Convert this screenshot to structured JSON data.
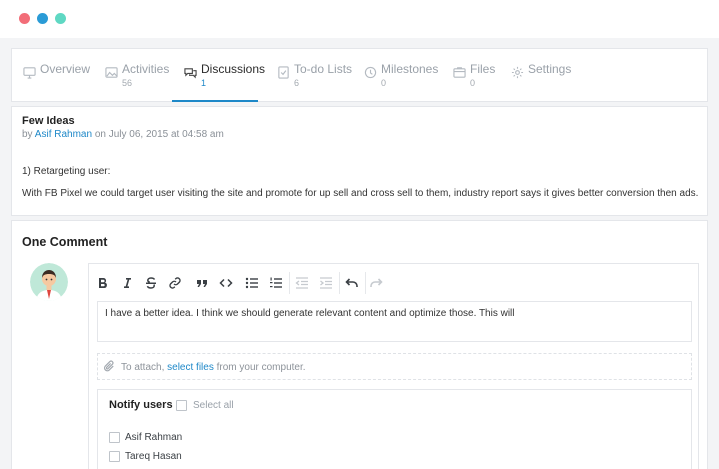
{
  "window": {
    "colors": {
      "close": "#f26d78",
      "minimize": "#2a9bd6",
      "maximize": "#5fd8c3"
    }
  },
  "tabs": [
    {
      "label": "Overview",
      "count": "",
      "icon": "monitor-icon"
    },
    {
      "label": "Activities",
      "count": "56",
      "icon": "image-icon"
    },
    {
      "label": "Discussions",
      "count": "1",
      "icon": "chat-icon",
      "active": true
    },
    {
      "label": "To-do Lists",
      "count": "6",
      "icon": "checklist-icon"
    },
    {
      "label": "Milestones",
      "count": "0",
      "icon": "clock-icon"
    },
    {
      "label": "Files",
      "count": "0",
      "icon": "folder-icon"
    },
    {
      "label": "Settings",
      "count": "",
      "icon": "gear-icon"
    }
  ],
  "post": {
    "title": "Few Ideas",
    "meta_prefix": "by ",
    "author": "Asif Rahman",
    "meta_suffix": " on July 06, 2015 at 04:58 am",
    "line1": "1) Retargeting user:",
    "line2": "With FB Pixel we could target user visiting the site and promote for up sell and cross sell to them, industry report says it gives better conversion then ads."
  },
  "comments": {
    "heading": "One Comment",
    "editor_text": "I have a better idea. I think we should generate relevant content and optimize those. This will",
    "attach_prefix": "To attach, ",
    "attach_link": "select files",
    "attach_suffix": " from your computer.",
    "notify_title": "Notify users",
    "select_all": "Select all",
    "users": [
      "Asif Rahman",
      "Tareq Hasan"
    ]
  },
  "accent_color": "#1e88c8"
}
